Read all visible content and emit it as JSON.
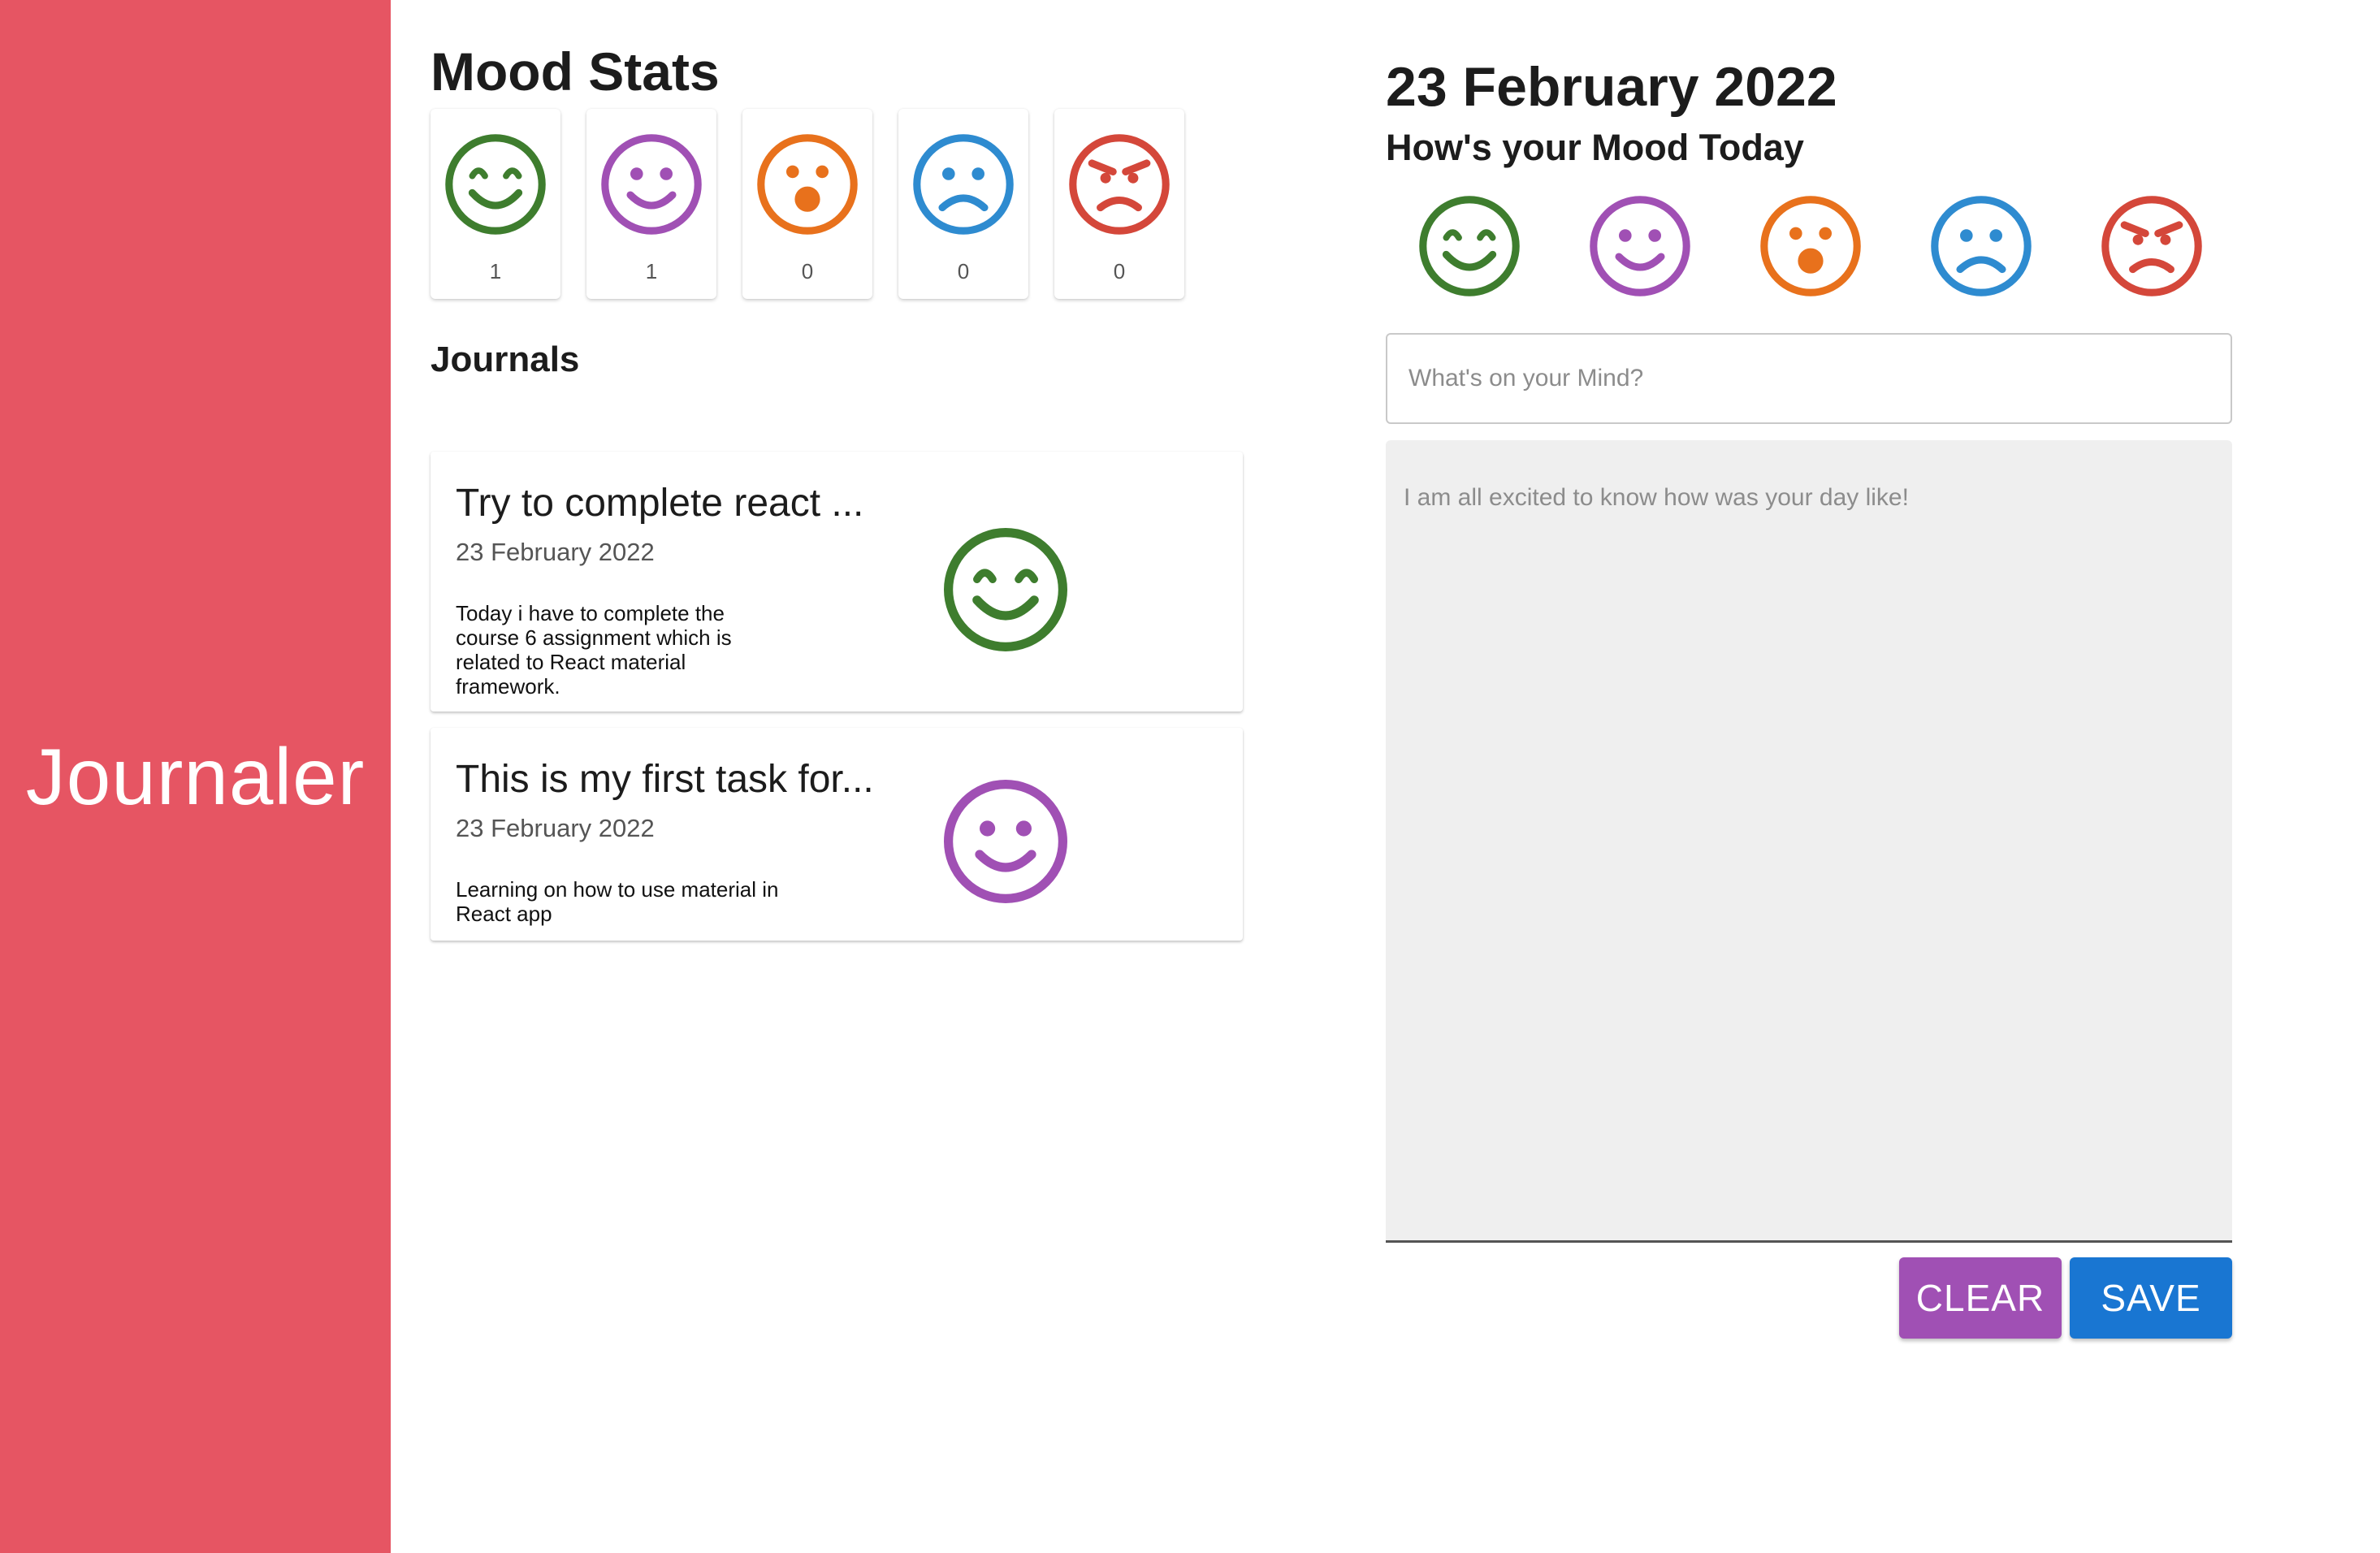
{
  "app": {
    "title": "Journaler"
  },
  "stats": {
    "title": "Mood Stats",
    "items": [
      {
        "mood": "grinning-icon",
        "color": "#3e7d2e",
        "count": "1"
      },
      {
        "mood": "smile-icon",
        "color": "#a050b4",
        "count": "1"
      },
      {
        "mood": "surprised-icon",
        "color": "#e8711c",
        "count": "0"
      },
      {
        "mood": "sad-icon",
        "color": "#2e8bd0",
        "count": "0"
      },
      {
        "mood": "angry-icon",
        "color": "#d4473a",
        "count": "0"
      }
    ]
  },
  "journals": {
    "title": "Journals",
    "entries": [
      {
        "title": "Try to complete react ...",
        "date": "23 February 2022",
        "body": "Today i have to complete the course 6 assignment which is related to React material framework.",
        "mood": "grinning-icon"
      },
      {
        "title": "This is my first task for...",
        "date": "23 February 2022",
        "body": "Learning on how to use material in React app",
        "mood": "smile-icon"
      }
    ]
  },
  "editor": {
    "date": "23 February 2022",
    "question": "How's your Mood Today",
    "title_placeholder": "What's on your Mind?",
    "body_placeholder": "I am all excited to know how was your day like!",
    "clear_label": "CLEAR",
    "save_label": "SAVE"
  }
}
